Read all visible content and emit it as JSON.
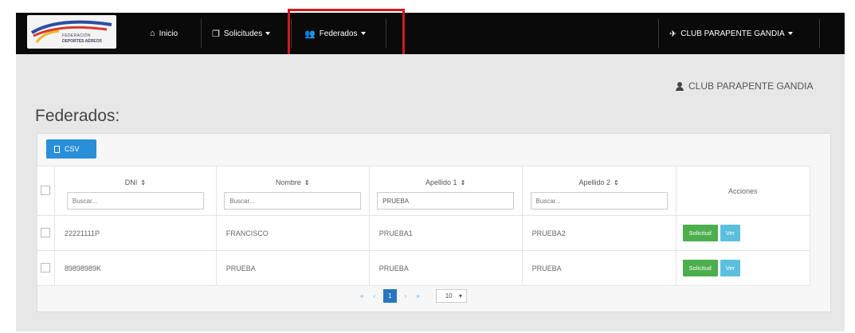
{
  "navbar": {
    "logo_text_line1": "FEDERACIÓN",
    "logo_text_line2": "DEPORTES AÉREOS",
    "items": [
      {
        "label": "Inicio",
        "icon": "home-icon"
      },
      {
        "label": "Solicitudes",
        "icon": "files-icon"
      },
      {
        "label": "Federados",
        "icon": "users-icon"
      }
    ],
    "club_menu_label": "CLUB PARAPENTE GANDIA",
    "club_menu_icon": "paper-plane-icon"
  },
  "header": {
    "club_name": "CLUB PARAPENTE GANDIA",
    "page_title": "Federados:"
  },
  "toolbar": {
    "csv_label": "CSV"
  },
  "table": {
    "columns": [
      {
        "label": "DNI",
        "filter_value": "",
        "filter_placeholder": "Buscar..."
      },
      {
        "label": "Nombre",
        "filter_value": "",
        "filter_placeholder": "Buscar..."
      },
      {
        "label": "Apellido 1",
        "filter_value": "PRUEBA",
        "filter_placeholder": "Buscar..."
      },
      {
        "label": "Apellido 2",
        "filter_value": "",
        "filter_placeholder": "Buscar..."
      }
    ],
    "actions_label": "Acciones",
    "sort_glyph": "⇕",
    "rows": [
      {
        "dni": "22221111P",
        "nombre": "FRANCISCO",
        "apellido1": "PRUEBA1",
        "apellido2": "PRUEBA2",
        "btn_solicitud": "Solicitud",
        "btn_ver": "Ver"
      },
      {
        "dni": "89898989K",
        "nombre": "PRUEBA",
        "apellido1": "PRUEBA",
        "apellido2": "PRUEBA",
        "btn_solicitud": "Solicitud",
        "btn_ver": "Ver"
      }
    ]
  },
  "pagination": {
    "first": "«",
    "prev": "‹",
    "current_page": "1",
    "next": "›",
    "last": "»",
    "page_size": "10"
  },
  "colors": {
    "navbar_bg": "#0a0a0a",
    "highlight_border": "#d11a1a",
    "csv_button": "#2a8fd8",
    "solicitud_button": "#4cae4c",
    "ver_button": "#5bc0de"
  }
}
